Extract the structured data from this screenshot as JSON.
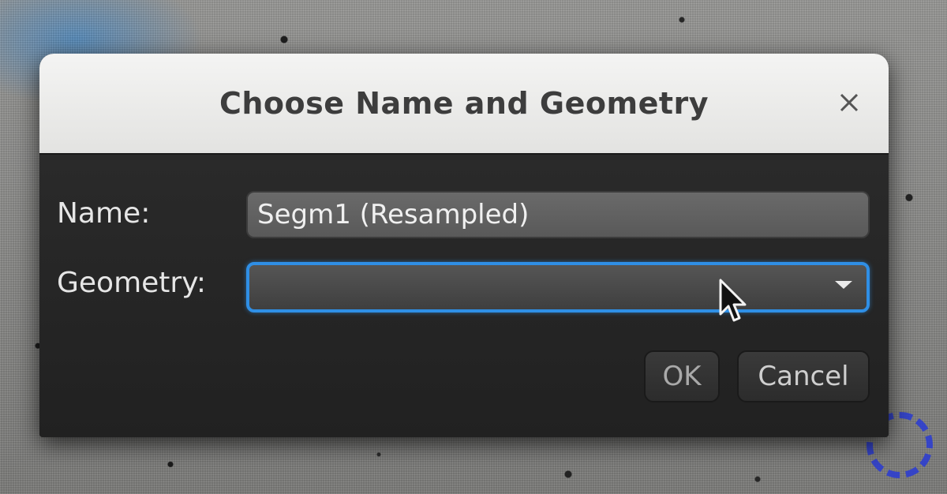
{
  "dialog": {
    "title": "Choose Name and Geometry",
    "close_icon": "close-icon",
    "name_label": "Name:",
    "name_value": "Segm1 (Resampled)",
    "geometry_label": "Geometry:",
    "geometry_value": "",
    "geometry_icon": "chevron-down-icon",
    "ok_label": "OK",
    "cancel_label": "Cancel"
  },
  "colors": {
    "focus_border": "#2f8fe6",
    "dialog_bg": "#252525",
    "titlebar_bg": "#ececea"
  }
}
